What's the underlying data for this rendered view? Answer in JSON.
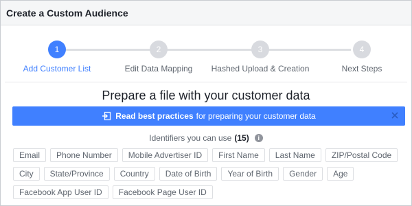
{
  "dialog": {
    "title": "Create a Custom Audience"
  },
  "stepper": {
    "steps": [
      {
        "number": "1",
        "label": "Add Customer List",
        "active": true
      },
      {
        "number": "2",
        "label": "Edit Data Mapping",
        "active": false
      },
      {
        "number": "3",
        "label": "Hashed Upload & Creation",
        "active": false
      },
      {
        "number": "4",
        "label": "Next Steps",
        "active": false
      }
    ]
  },
  "main": {
    "heading": "Prepare a file with your customer data",
    "banner": {
      "strong_text": "Read best practices",
      "text": "for preparing your customer data",
      "close_glyph": "✕"
    },
    "identifiers": {
      "label": "Identifiers you can use",
      "count": "(15)",
      "info_glyph": "i",
      "items": [
        "Email",
        "Phone Number",
        "Mobile Advertiser ID",
        "First Name",
        "Last Name",
        "ZIP/Postal Code",
        "City",
        "State/Province",
        "Country",
        "Date of Birth",
        "Year of Birth",
        "Gender",
        "Age",
        "Facebook App User ID",
        "Facebook Page User ID"
      ]
    }
  },
  "colors": {
    "accent": "#4080ff",
    "inactive_step": "#d8dadf",
    "muted_text": "#606770"
  }
}
